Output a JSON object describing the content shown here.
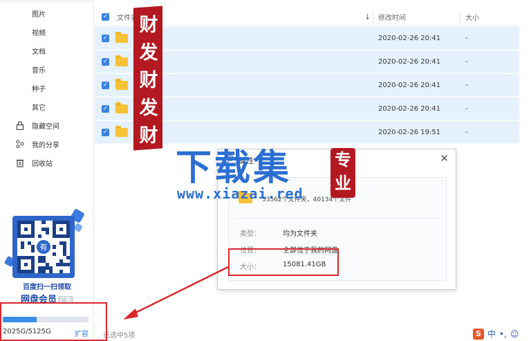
{
  "sidebar": {
    "items": [
      {
        "label": "图片"
      },
      {
        "label": "视频"
      },
      {
        "label": "文档"
      },
      {
        "label": "音乐"
      },
      {
        "label": "种子"
      },
      {
        "label": "其它"
      },
      {
        "label": "隐藏空间",
        "icon": "lock-icon"
      },
      {
        "label": "我的分享",
        "icon": "share-icon"
      },
      {
        "label": "回收站",
        "icon": "trash-icon"
      }
    ],
    "promo": {
      "line1": "百度扫一扫领取",
      "line2": "网盘会员",
      "badge": "广告"
    },
    "storage": {
      "text": "2025G/5125G",
      "expand_label": "扩容",
      "used_fraction": 0.395
    }
  },
  "file_list": {
    "columns": {
      "name": "文件名",
      "modified": "修改时间",
      "size": "大小"
    },
    "rows": [
      {
        "date": "2020-02-26 20:41",
        "size": "-"
      },
      {
        "date": "2020-02-26 20:41",
        "size": "-"
      },
      {
        "date": "2020-02-26 20:41",
        "size": "-"
      },
      {
        "date": "2020-02-26 20:41",
        "size": "-"
      },
      {
        "date": "2020-02-26 19:51",
        "size": "-"
      }
    ],
    "status": "已选中5项"
  },
  "dialog": {
    "title": "属性",
    "summary": "33562个文件夹，40134个文件",
    "type_label": "类型：",
    "type_value": "均为文件夹",
    "location_label": "位置：",
    "location_value": "全部位于我的网盘",
    "size_label": "大小：",
    "size_value": "15081.41GB"
  },
  "ime": {
    "logo": "S",
    "mode": "中",
    "extra": "•,"
  },
  "watermark": {
    "vertical_chars": [
      "财",
      "发",
      "财",
      "发",
      "财"
    ],
    "main": "下载集",
    "url": "www.xiazai.red",
    "pro": [
      "专",
      "业"
    ]
  }
}
